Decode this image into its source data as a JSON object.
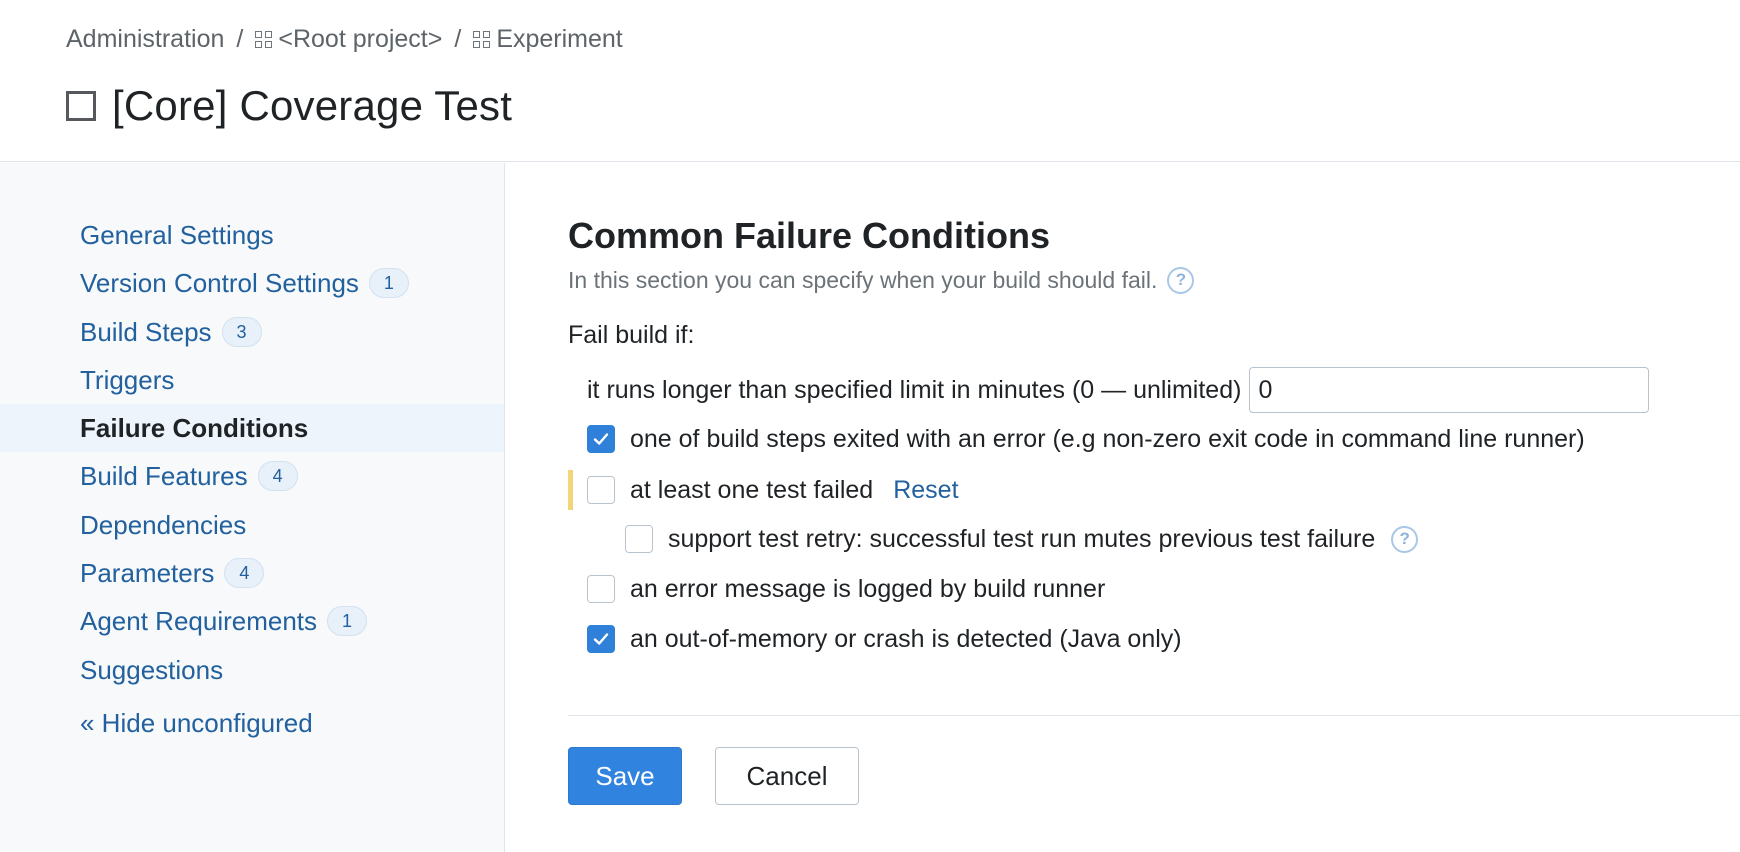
{
  "breadcrumb": {
    "items": [
      "Administration",
      "<Root project>",
      "Experiment"
    ],
    "separator": "/"
  },
  "page": {
    "title": "[Core] Coverage Test"
  },
  "sidebar": {
    "items": [
      {
        "label": "General Settings",
        "badge": null
      },
      {
        "label": "Version Control Settings",
        "badge": "1"
      },
      {
        "label": "Build Steps",
        "badge": "3"
      },
      {
        "label": "Triggers",
        "badge": null
      },
      {
        "label": "Failure Conditions",
        "badge": null,
        "active": true
      },
      {
        "label": "Build Features",
        "badge": "4"
      },
      {
        "label": "Dependencies",
        "badge": null
      },
      {
        "label": "Parameters",
        "badge": "4"
      },
      {
        "label": "Agent Requirements",
        "badge": "1"
      },
      {
        "label": "Suggestions",
        "badge": null
      }
    ],
    "hide_link": "« Hide unconfigured"
  },
  "main": {
    "section_title": "Common Failure Conditions",
    "section_desc": "In this section you can specify when your build should fail.",
    "fail_label": "Fail build if:",
    "timeout": {
      "label": "it runs longer than specified limit in minutes (0 — unlimited)",
      "value": "0"
    },
    "conditions": [
      {
        "label": "one of build steps exited with an error (e.g non-zero exit code in command line runner)",
        "checked": true
      },
      {
        "label": "at least one test failed",
        "checked": false,
        "reset": "Reset",
        "changed": true
      },
      {
        "label": "support test retry: successful test run mutes previous test failure",
        "checked": false,
        "nested": true,
        "help": true
      },
      {
        "label": "an error message is logged by build runner",
        "checked": false
      },
      {
        "label": "an out-of-memory or crash is detected (Java only)",
        "checked": true
      }
    ]
  },
  "buttons": {
    "save": "Save",
    "cancel": "Cancel"
  },
  "colors": {
    "link": "#22609e",
    "accent": "#3183e0",
    "changed_marker": "#f1d578"
  }
}
